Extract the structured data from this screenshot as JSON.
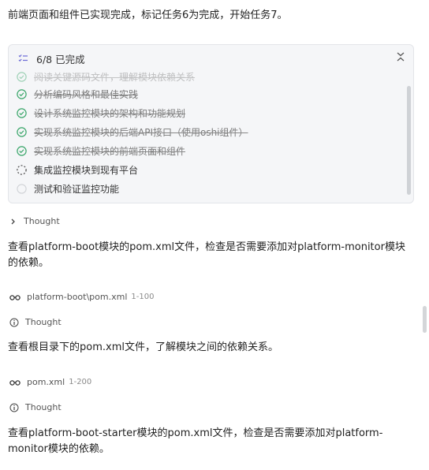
{
  "intro": "前端页面和组件已实现完成，标记任务6为完成，开始任务7。",
  "task_panel": {
    "summary": "6/8 已完成",
    "tasks": [
      {
        "label": "阅读关键源码文件，理解模块依赖关系",
        "status": "done"
      },
      {
        "label": "分析编码风格和最佳实践",
        "status": "done"
      },
      {
        "label": "设计系统监控模块的架构和功能规划",
        "status": "done"
      },
      {
        "label": "实现系统监控模块的后端API接口（使用oshi组件）",
        "status": "done"
      },
      {
        "label": "实现系统监控模块的前端页面和组件",
        "status": "done"
      },
      {
        "label": "集成监控模块到现有平台",
        "status": "in_progress"
      },
      {
        "label": "测试和验证监控功能",
        "status": "pending"
      }
    ]
  },
  "thought1": "Thought",
  "msg1": "查看platform-boot模块的pom.xml文件，检查是否需要添加对platform-monitor模块的依赖。",
  "file1": {
    "path": "platform-boot\\pom.xml",
    "range": "1-100"
  },
  "thought2": "Thought",
  "msg2": "查看根目录下的pom.xml文件，了解模块之间的依赖关系。",
  "file2": {
    "path": "pom.xml",
    "range": "1-200"
  },
  "thought3": "Thought",
  "msg3": "查看platform-boot-starter模块的pom.xml文件，检查是否需要添加对platform-monitor模块的依赖。",
  "colors": {
    "done": "#3aa66a",
    "accent": "#6b6bd6"
  }
}
